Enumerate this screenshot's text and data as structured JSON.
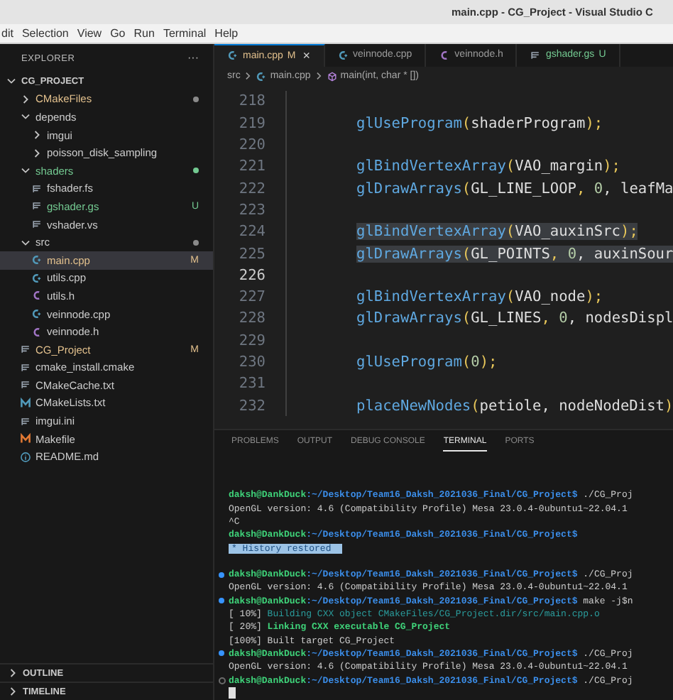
{
  "window": {
    "title": "main.cpp - CG_Project - Visual Studio C"
  },
  "menu": [
    "dit",
    "Selection",
    "View",
    "Go",
    "Run",
    "Terminal",
    "Help"
  ],
  "explorer": {
    "title": "EXPLORER",
    "more": "···",
    "root": {
      "label": "CG_PROJECT",
      "expanded": true
    },
    "items": [
      {
        "label": "CMakeFiles",
        "kind": "folder",
        "expanded": false,
        "modified": true,
        "untracked": false,
        "dot": true
      },
      {
        "label": "depends",
        "kind": "folder",
        "expanded": true,
        "modified": false,
        "untracked": false,
        "dot": false,
        "children": [
          {
            "label": "imgui",
            "kind": "folder",
            "expanded": false,
            "modified": false,
            "untracked": false,
            "dot": false
          },
          {
            "label": "poisson_disk_sampling",
            "kind": "folder",
            "expanded": false,
            "modified": false,
            "untracked": false,
            "dot": false
          }
        ]
      },
      {
        "label": "shaders",
        "kind": "folder",
        "expanded": true,
        "modified": false,
        "untracked": true,
        "dot": true,
        "children": [
          {
            "label": "fshader.fs",
            "kind": "text",
            "modified": false,
            "untracked": false,
            "selected": false
          },
          {
            "label": "gshader.gs",
            "kind": "text",
            "modified": false,
            "untracked": true,
            "badge": "U",
            "selected": false
          },
          {
            "label": "vshader.vs",
            "kind": "text",
            "modified": false,
            "untracked": false,
            "selected": false
          }
        ]
      },
      {
        "label": "src",
        "kind": "folder",
        "expanded": true,
        "modified": false,
        "untracked": false,
        "dot": true,
        "children": [
          {
            "label": "main.cpp",
            "kind": "cpp",
            "modified": true,
            "untracked": false,
            "badge": "M",
            "selected": true
          },
          {
            "label": "utils.cpp",
            "kind": "cpp",
            "modified": false,
            "untracked": false,
            "selected": false
          },
          {
            "label": "utils.h",
            "kind": "header",
            "modified": false,
            "untracked": false,
            "selected": false
          },
          {
            "label": "veinnode.cpp",
            "kind": "cpp",
            "modified": false,
            "untracked": false,
            "selected": false
          },
          {
            "label": "veinnode.h",
            "kind": "header",
            "modified": false,
            "untracked": false,
            "selected": false
          }
        ]
      },
      {
        "label": "CG_Project",
        "kind": "text",
        "modified": true,
        "untracked": false,
        "badge": "M",
        "selected": false
      },
      {
        "label": "cmake_install.cmake",
        "kind": "text",
        "modified": false,
        "untracked": false,
        "selected": false
      },
      {
        "label": "CMakeCache.txt",
        "kind": "text",
        "modified": false,
        "untracked": false,
        "selected": false
      },
      {
        "label": "CMakeLists.txt",
        "kind": "cmake",
        "modified": false,
        "untracked": false,
        "selected": false
      },
      {
        "label": "imgui.ini",
        "kind": "text",
        "modified": false,
        "untracked": false,
        "selected": false
      },
      {
        "label": "Makefile",
        "kind": "make",
        "modified": false,
        "untracked": false,
        "selected": false
      },
      {
        "label": "README.md",
        "kind": "info",
        "modified": false,
        "untracked": false,
        "selected": false
      }
    ],
    "sections": [
      {
        "label": "OUTLINE",
        "expanded": false
      },
      {
        "label": "TIMELINE",
        "expanded": false
      }
    ]
  },
  "tabs": [
    {
      "label": "main.cpp",
      "kind": "cpp",
      "badge": "M",
      "close": "×",
      "selected": true,
      "modified": true,
      "untracked": false
    },
    {
      "label": "veinnode.cpp",
      "kind": "cpp",
      "selected": false,
      "modified": false,
      "untracked": false
    },
    {
      "label": "veinnode.h",
      "kind": "header",
      "selected": false,
      "modified": false,
      "untracked": false
    },
    {
      "label": "gshader.gs",
      "kind": "text",
      "badge": "U",
      "selected": false,
      "modified": false,
      "untracked": true
    }
  ],
  "breadcrumb": [
    "src",
    "main.cpp",
    "main(int, char * [])"
  ],
  "code": [
    {
      "number": "218",
      "selected": false,
      "current": false
    },
    {
      "number": "219",
      "selected": false,
      "current": false,
      "tokens": [
        {
          "text": "glUseProgram",
          "kind": "fn"
        },
        {
          "text": "(",
          "kind": "punct"
        },
        {
          "text": "shaderProgram",
          "kind": "var"
        },
        {
          "text": ");",
          "kind": "punct"
        }
      ]
    },
    {
      "number": "220",
      "selected": false,
      "current": false
    },
    {
      "number": "221",
      "selected": false,
      "current": false,
      "tokens": [
        {
          "text": "glBindVertexArray",
          "kind": "fn"
        },
        {
          "text": "(",
          "kind": "punct"
        },
        {
          "text": "VAO_margin",
          "kind": "var"
        },
        {
          "text": ");",
          "kind": "punct"
        }
      ]
    },
    {
      "number": "222",
      "selected": false,
      "current": false,
      "tokens": [
        {
          "text": "glDrawArrays",
          "kind": "fn"
        },
        {
          "text": "(",
          "kind": "punct"
        },
        {
          "text": "GL_LINE_LOOP",
          "kind": "var"
        },
        {
          "text": ", ",
          "kind": "punct"
        },
        {
          "text": "0",
          "kind": "num"
        },
        {
          "text": ", leafMa",
          "kind": "var"
        }
      ]
    },
    {
      "number": "223",
      "selected": false,
      "current": false
    },
    {
      "number": "224",
      "selected": true,
      "current": false,
      "tokens": [
        {
          "text": "glBindVertexArray",
          "kind": "fn"
        },
        {
          "text": "(",
          "kind": "punct"
        },
        {
          "text": "VAO_auxinSrc",
          "kind": "var"
        },
        {
          "text": ");",
          "kind": "punct"
        }
      ]
    },
    {
      "number": "225",
      "selected": true,
      "current": false,
      "tokens": [
        {
          "text": "glDrawArrays",
          "kind": "fn"
        },
        {
          "text": "(",
          "kind": "punct"
        },
        {
          "text": "GL_POINTS",
          "kind": "var"
        },
        {
          "text": ", ",
          "kind": "punct"
        },
        {
          "text": "0",
          "kind": "num"
        },
        {
          "text": ", auxinSour",
          "kind": "var"
        }
      ]
    },
    {
      "number": "226",
      "selected": false,
      "current": true
    },
    {
      "number": "227",
      "selected": false,
      "current": false,
      "tokens": [
        {
          "text": "glBindVertexArray",
          "kind": "fn"
        },
        {
          "text": "(",
          "kind": "punct"
        },
        {
          "text": "VAO_node",
          "kind": "var"
        },
        {
          "text": ");",
          "kind": "punct"
        }
      ]
    },
    {
      "number": "228",
      "selected": false,
      "current": false,
      "tokens": [
        {
          "text": "glDrawArrays",
          "kind": "fn"
        },
        {
          "text": "(",
          "kind": "punct"
        },
        {
          "text": "GL_LINES",
          "kind": "var"
        },
        {
          "text": ", ",
          "kind": "punct"
        },
        {
          "text": "0",
          "kind": "num"
        },
        {
          "text": ", nodesDispl",
          "kind": "var"
        }
      ]
    },
    {
      "number": "229",
      "selected": false,
      "current": false
    },
    {
      "number": "230",
      "selected": false,
      "current": false,
      "tokens": [
        {
          "text": "glUseProgram",
          "kind": "fn"
        },
        {
          "text": "(",
          "kind": "punct"
        },
        {
          "text": "0",
          "kind": "num"
        },
        {
          "text": ");",
          "kind": "punct"
        }
      ]
    },
    {
      "number": "231",
      "selected": false,
      "current": false
    },
    {
      "number": "232",
      "selected": false,
      "current": false,
      "tokens": [
        {
          "text": "placeNewNodes",
          "kind": "fn"
        },
        {
          "text": "(",
          "kind": "punct"
        },
        {
          "text": "petiole, nodeNodeDist",
          "kind": "var"
        },
        {
          "text": ")",
          "kind": "punct"
        }
      ]
    }
  ],
  "panel": {
    "tabs": [
      {
        "label": "PROBLEMS",
        "selected": false
      },
      {
        "label": "OUTPUT",
        "selected": false
      },
      {
        "label": "DEBUG CONSOLE",
        "selected": false
      },
      {
        "label": "TERMINAL",
        "selected": true
      },
      {
        "label": "PORTS",
        "selected": false
      }
    ],
    "terminal": [
      {
        "kind": "prompt",
        "user": "daksh@DankDuck",
        "path": ":~/Desktop/Team16_Daksh_2021036_Final/CG_Project$",
        "command": " ./CG_Proj",
        "decorated": false
      },
      {
        "kind": "plain",
        "text": "OpenGL version: 4.6 (Compatibility Profile) Mesa 23.0.4-0ubuntu1~22.04.1"
      },
      {
        "kind": "plain",
        "text": "^C"
      },
      {
        "kind": "prompt",
        "user": "daksh@DankDuck",
        "path": ":~/Desktop/Team16_Daksh_2021036_Final/CG_Project$",
        "decorated": false
      },
      {
        "kind": "notice",
        "marker": "*",
        "text": "History restored"
      },
      {
        "kind": "blank"
      },
      {
        "kind": "prompt",
        "user": "daksh@DankDuck",
        "path": ":~/Desktop/Team16_Daksh_2021036_Final/CG_Project$",
        "command": " ./CG_Proj",
        "decorated": true,
        "done": true
      },
      {
        "kind": "plain",
        "text": "OpenGL version: 4.6 (Compatibility Profile) Mesa 23.0.4-0ubuntu1~22.04.1"
      },
      {
        "kind": "prompt",
        "user": "daksh@DankDuck",
        "path": ":~/Desktop/Team16_Daksh_2021036_Final/CG_Project$",
        "command": " make -j$n",
        "decorated": true,
        "done": true
      },
      {
        "kind": "build",
        "percent": "[ 10%]",
        "text": " Building CXX object CMakeFiles/CG_Project.dir/src/main.cpp.o",
        "faint": true,
        "bold": false
      },
      {
        "kind": "build",
        "percent": "[ 20%]",
        "text": " Linking CXX executable CG_Project",
        "faint": false,
        "bold": true
      },
      {
        "kind": "build",
        "percent": "[100%]",
        "text": " Built target CG_Project",
        "faint": false,
        "bold": false
      },
      {
        "kind": "prompt",
        "user": "daksh@DankDuck",
        "path": ":~/Desktop/Team16_Daksh_2021036_Final/CG_Project$",
        "command": " ./CG_Proj",
        "decorated": true,
        "done": true
      },
      {
        "kind": "plain",
        "text": "OpenGL version: 4.6 (Compatibility Profile) Mesa 23.0.4-0ubuntu1~22.04.1"
      },
      {
        "kind": "prompt",
        "user": "daksh@DankDuck",
        "path": ":~/Desktop/Team16_Daksh_2021036_Final/CG_Project$",
        "command": " ./CG_Proj",
        "decorated": true,
        "done": false
      },
      {
        "kind": "cursor"
      }
    ]
  }
}
